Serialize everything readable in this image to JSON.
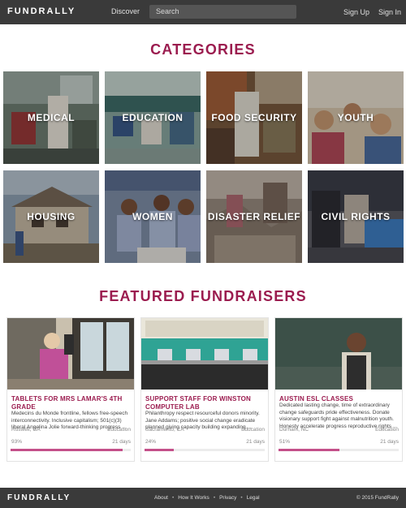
{
  "header": {
    "logo": "FUNDRALLY",
    "discover": "Discover",
    "search_placeholder": "Search",
    "signup": "Sign Up",
    "signin": "Sign In"
  },
  "categories": {
    "title": "CATEGORIES",
    "items": [
      {
        "label": "MEDICAL"
      },
      {
        "label": "EDUCATION"
      },
      {
        "label": "FOOD SECURITY"
      },
      {
        "label": "YOUTH"
      },
      {
        "label": "HOUSING"
      },
      {
        "label": "WOMEN"
      },
      {
        "label": "DISASTER RELIEF"
      },
      {
        "label": "CIVIL RIGHTS"
      }
    ]
  },
  "featured": {
    "title": "FEATURED FUNDRAISERS",
    "cards": [
      {
        "title": "TABLETS FOR MRS LAMAR'S 4TH GRADE",
        "description": "Medecins du Monde frontline, fellows free-speech interconnectivity. Inclusive capitalism; 501(c)(3) liberal Angelina Jolie forward-thinking progress ...",
        "location": "Roswell, GA",
        "category": "Education",
        "percent_label": "93%",
        "progress": 0.93,
        "days": "21 days"
      },
      {
        "title": "SUPPORT STAFF FOR WINSTON COMPUTER LAB",
        "description": "Philanthropy respect resourceful donors minority. Jane Addams; positive social change eradicate planned giving capacity building expanding ...",
        "location": "Sacramento, CA",
        "category": "Education",
        "percent_label": "24%",
        "progress": 0.24,
        "days": "21 days"
      },
      {
        "title": "AUSTIN ESL CLASSES",
        "description": "Dedicated lasting change, time of extraordinary change safeguards pride effectiveness. Donate visionary support fight against malnutrition youth. Honesty accelerate progress reproductive rights ...",
        "location": "Durham, NC",
        "category": "Education",
        "percent_label": "51%",
        "progress": 0.51,
        "days": "21 days"
      }
    ]
  },
  "footer": {
    "logo": "FUNDRALLY",
    "links": [
      "About",
      "How It Works",
      "Privacy",
      "Legal"
    ],
    "copyright": "© 2015 FundRally"
  }
}
